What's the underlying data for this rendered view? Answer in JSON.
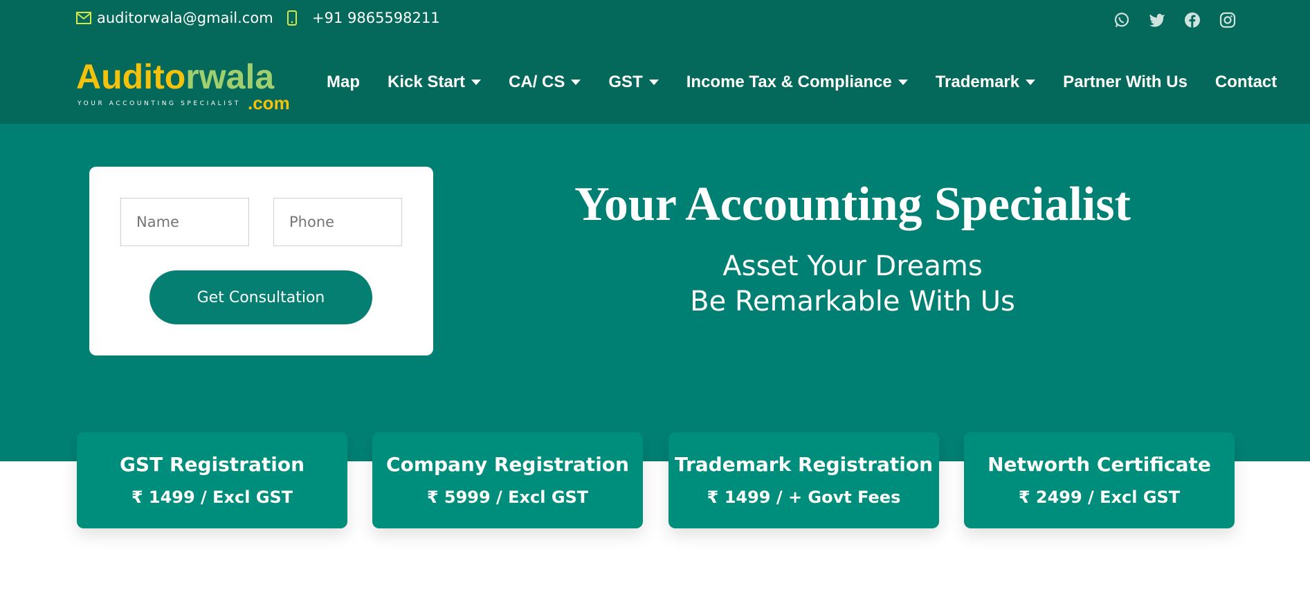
{
  "topbar": {
    "email": "auditorwala@gmail.com",
    "phone": "+91 9865598211",
    "socials": [
      "whatsapp-icon",
      "twitter-icon",
      "facebook-icon",
      "instagram-icon"
    ]
  },
  "logo": {
    "brand_first": "Aud",
    "brand_mid": "it",
    "brand_o": "o",
    "brand_rest": "rwala",
    "domain": ".com",
    "tagline": "YOUR ACCOUNTING SPECIALIST"
  },
  "nav": {
    "items": [
      {
        "label": "Map",
        "dropdown": false
      },
      {
        "label": "Kick Start",
        "dropdown": true
      },
      {
        "label": "CA/ CS",
        "dropdown": true
      },
      {
        "label": "GST",
        "dropdown": true
      },
      {
        "label": "Income Tax & Compliance",
        "dropdown": true
      },
      {
        "label": "Trademark",
        "dropdown": true
      },
      {
        "label": "Partner With Us",
        "dropdown": false
      },
      {
        "label": "Contact",
        "dropdown": false
      }
    ]
  },
  "form": {
    "name_placeholder": "Name",
    "phone_placeholder": "Phone",
    "submit_label": "Get Consultation"
  },
  "hero": {
    "title": "Your Accounting Specialist",
    "line1": "Asset Your Dreams",
    "line2": "Be Remarkable With Us"
  },
  "services": [
    {
      "title": "GST Registration",
      "price": "₹ 1499 / Excl GST"
    },
    {
      "title": "Company Registration",
      "price": "₹ 5999 / Excl GST"
    },
    {
      "title": "Trademark Registration",
      "price": "₹ 1499 / + Govt Fees"
    },
    {
      "title": "Networth Certificate",
      "price": "₹ 2499 / Excl GST"
    }
  ],
  "colors": {
    "header_bg": "#04685a",
    "hero_bg": "#008073",
    "card_bg": "#008e7c",
    "accent_yellow": "#f4c20d",
    "icon_yellow": "#d6e84a"
  }
}
